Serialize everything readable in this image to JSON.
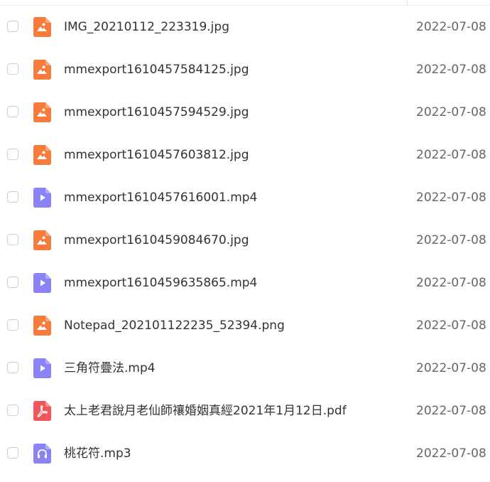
{
  "colors": {
    "image": "#f77b3b",
    "video": "#8b83f5",
    "pdf": "#f0555a",
    "audio": "#8b83f5",
    "name_text": "#333333",
    "date_text": "#666666"
  },
  "files": [
    {
      "name": "IMG_20210112_223319.jpg",
      "date": "2022-07-08",
      "type": "image",
      "icon": "image-file-icon"
    },
    {
      "name": "mmexport1610457584125.jpg",
      "date": "2022-07-08",
      "type": "image",
      "icon": "image-file-icon"
    },
    {
      "name": "mmexport1610457594529.jpg",
      "date": "2022-07-08",
      "type": "image",
      "icon": "image-file-icon"
    },
    {
      "name": "mmexport1610457603812.jpg",
      "date": "2022-07-08",
      "type": "image",
      "icon": "image-file-icon"
    },
    {
      "name": "mmexport1610457616001.mp4",
      "date": "2022-07-08",
      "type": "video",
      "icon": "video-file-icon"
    },
    {
      "name": "mmexport1610459084670.jpg",
      "date": "2022-07-08",
      "type": "image",
      "icon": "image-file-icon"
    },
    {
      "name": "mmexport1610459635865.mp4",
      "date": "2022-07-08",
      "type": "video",
      "icon": "video-file-icon"
    },
    {
      "name": "Notepad_202101122235_52394.png",
      "date": "2022-07-08",
      "type": "image",
      "icon": "image-file-icon"
    },
    {
      "name": "三角符疊法.mp4",
      "date": "2022-07-08",
      "type": "video",
      "icon": "video-file-icon"
    },
    {
      "name": "太上老君說月老仙師禳婚姻真經2021年1月12日.pdf",
      "date": "2022-07-08",
      "type": "pdf",
      "icon": "pdf-file-icon"
    },
    {
      "name": "桃花符.mp3",
      "date": "2022-07-08",
      "type": "audio",
      "icon": "audio-file-icon"
    }
  ]
}
